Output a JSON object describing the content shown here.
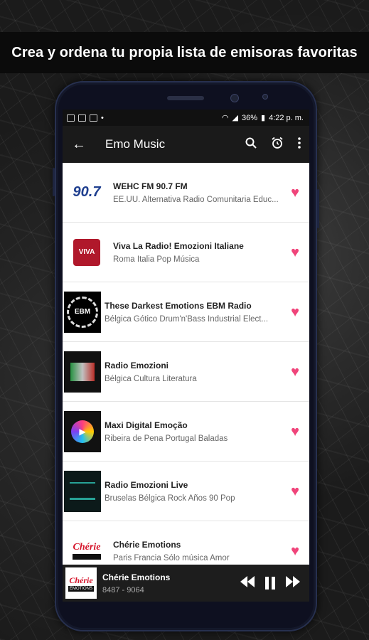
{
  "banner": {
    "headline": "Crea y ordena tu propia lista de emisoras favoritas"
  },
  "statusbar": {
    "battery": "36%",
    "time": "4:22 p. m."
  },
  "appbar": {
    "back_icon": "arrow-left-icon",
    "title": "Emo Music",
    "actions": [
      "search-icon",
      "alarm-icon",
      "more-vert-icon"
    ]
  },
  "stations": [
    {
      "name": "WEHC FM 90.7 FM",
      "desc": "EE.UU. Alternativa Radio Comunitaria Educ...",
      "logo_text": "90.7",
      "favorite": true
    },
    {
      "name": "Viva La Radio! Emozioni Italiane",
      "desc": "Roma Italia Pop Música",
      "logo_text": "VIVA",
      "favorite": true
    },
    {
      "name": "These Darkest Emotions EBM Radio",
      "desc": "Bélgica Gótico Drum'n'Bass Industrial Elect...",
      "logo_text": "EBM",
      "favorite": true
    },
    {
      "name": "Radio Emozioni",
      "desc": "Bélgica Cultura Literatura",
      "logo_text": "",
      "favorite": true
    },
    {
      "name": "Maxi Digital Emoção",
      "desc": "Ribeira de Pena Portugal Baladas",
      "logo_text": "",
      "favorite": true
    },
    {
      "name": "Radio Emozioni Live",
      "desc": "Bruselas Bélgica Rock Años 90 Pop",
      "logo_text": "",
      "favorite": true
    },
    {
      "name": "Chérie Emotions",
      "desc": "Paris Francia Sólo música Amor",
      "logo_text": "Chérie",
      "favorite": true
    }
  ],
  "player": {
    "title": "Chérie Emotions",
    "subtitle": "8487 - 9064",
    "logo_text_top": "Chérie",
    "logo_text_bottom": "EMOTIONS",
    "controls": [
      "rewind-icon",
      "pause-icon",
      "fast-forward-icon"
    ]
  },
  "colors": {
    "heart": "#f0447a",
    "appbar": "#1a1a1a",
    "player": "#1d1d1d"
  }
}
